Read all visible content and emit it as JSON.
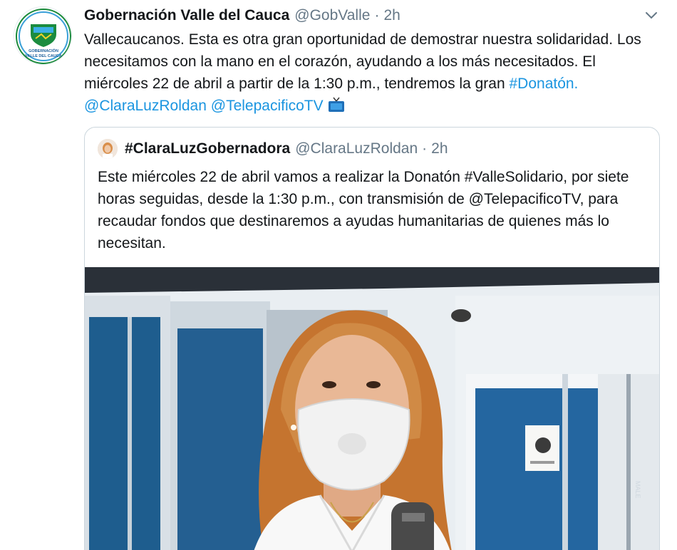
{
  "tweet": {
    "author_name": "Gobernación Valle del Cauca",
    "author_handle": "@GobValle",
    "separator": "·",
    "time": "2h",
    "avatar_text_line1": "GOBERNACIÓN",
    "avatar_text_line2": "VALLE DEL CAUCA",
    "text_plain": "Vallecaucanos. Esta es otra gran oportunidad de demostrar nuestra solidaridad. Los necesitamos con la mano en el corazón, ayudando a los más necesitados. El miércoles 22 de abril a partir de la 1:30 p.m., tendremos la gran ",
    "hashtag": "#Donatón.",
    "mention1": "@ClaraLuzRoldan",
    "mention2": "@TelepacificoTV",
    "emoji_icon": "television-icon"
  },
  "quoted": {
    "author_name": "#ClaraLuzGobernadora",
    "author_handle": "@ClaraLuzRoldan",
    "separator": "·",
    "time": "2h",
    "text": "Este miércoles 22 de abril vamos a realizar la Donatón #ValleSolidario, por siete horas seguidas, desde la 1:30 p.m., con transmisión de @TelepacificoTV, para recaudar fondos que destinaremos a ayudas humanitarias de quienes más lo necesitan.",
    "media_sign_text": "MALE"
  },
  "colors": {
    "link": "#1b95e0",
    "secondary_text": "#657786",
    "border": "#ccd6dd"
  }
}
